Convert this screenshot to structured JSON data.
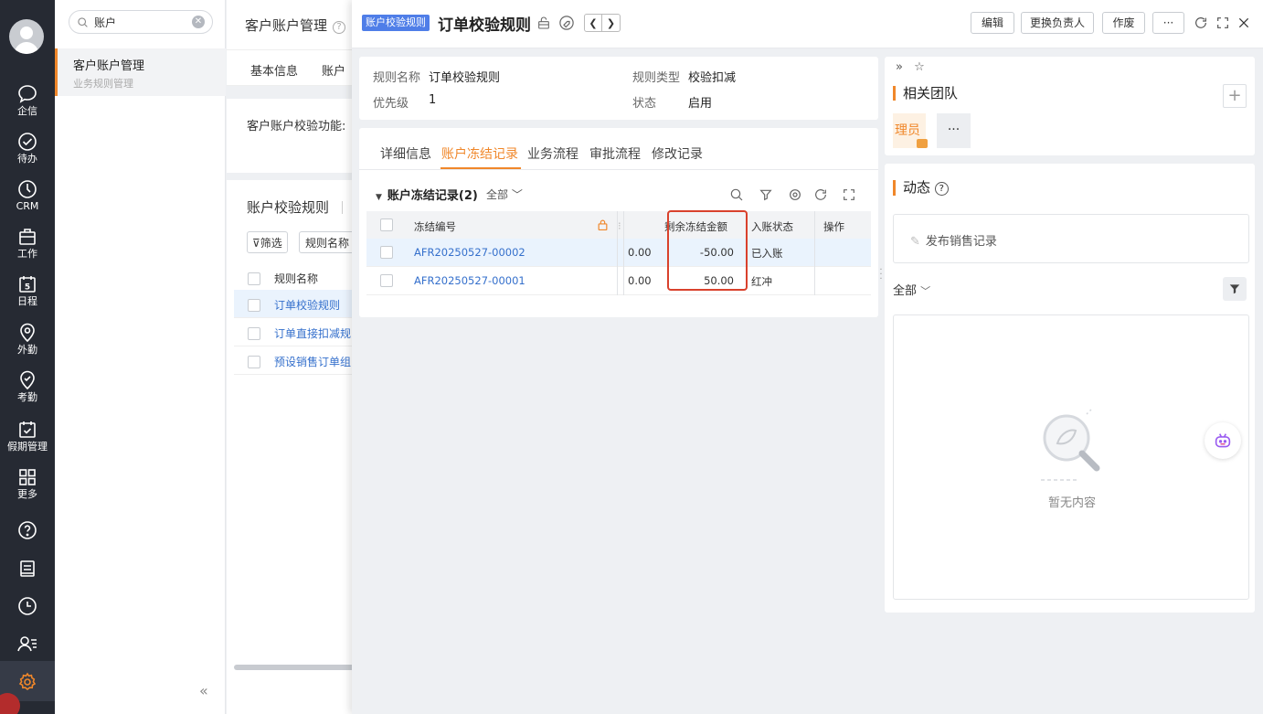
{
  "rail": {
    "items": [
      {
        "icon": "chat-icon",
        "label": "企信"
      },
      {
        "icon": "check-circle-icon",
        "label": "待办"
      },
      {
        "icon": "crm-icon",
        "label": "CRM"
      },
      {
        "icon": "briefcase-icon",
        "label": "工作"
      },
      {
        "icon": "calendar-icon",
        "label": "日程",
        "badge": "5"
      },
      {
        "icon": "location-icon",
        "label": "外勤"
      },
      {
        "icon": "attendance-icon",
        "label": "考勤"
      },
      {
        "icon": "calendar-check-icon",
        "label": "假期管理"
      },
      {
        "icon": "grid-icon",
        "label": "更多"
      }
    ]
  },
  "sidebar": {
    "search_value": "账户",
    "item_title": "客户账户管理",
    "item_sub": "业务规则管理",
    "collapse": "«"
  },
  "bgpage": {
    "title": "客户账户管理",
    "tabs": [
      "基本信息",
      "账户"
    ],
    "func_label": "客户账户校验功能:",
    "rules_title": "账户校验规则",
    "filter_label": "筛选",
    "select_label": "规则名称",
    "col_header": "规则名称",
    "rows": [
      "订单校验规则",
      "订单直接扣减规",
      "预设销售订单组"
    ]
  },
  "drawer": {
    "tag": "账户校验规则",
    "title": "订单校验规则",
    "buttons": {
      "edit": "编辑",
      "change_owner": "更换负责人",
      "void": "作废",
      "more": "···"
    },
    "info": {
      "rule_name_label": "规则名称",
      "rule_name": "订单校验规则",
      "rule_type_label": "规则类型",
      "rule_type": "校验扣减",
      "priority_label": "优先级",
      "priority": "1",
      "status_label": "状态",
      "status": "启用"
    },
    "tabs": [
      "详细信息",
      "账户冻结记录",
      "业务流程",
      "审批流程",
      "修改记录"
    ],
    "active_tab": "账户冻结记录",
    "section_title": "账户冻结记录(2)",
    "section_filter": "全部",
    "table": {
      "headers": {
        "code": "冻结编号",
        "remaining": "剩余冻结金额",
        "status": "入账状态",
        "action": "操作"
      },
      "rows": [
        {
          "code": "AFR20250527-00002",
          "amount": "0.00",
          "remaining": "-50.00",
          "status": "已入账"
        },
        {
          "code": "AFR20250527-00001",
          "amount": "0.00",
          "remaining": "50.00",
          "status": "红冲"
        }
      ]
    }
  },
  "right": {
    "team_title": "相关团队",
    "member": "理员",
    "more": "···",
    "feed_title": "动态",
    "post_placeholder": "发布销售记录",
    "feed_filter": "全部",
    "empty_text": "暂无内容"
  },
  "colors": {
    "accent": "#f0872a",
    "link": "#3570cc",
    "tag": "#4f7ee8",
    "highlight_box": "#d9412c",
    "rail": "#262a33"
  }
}
